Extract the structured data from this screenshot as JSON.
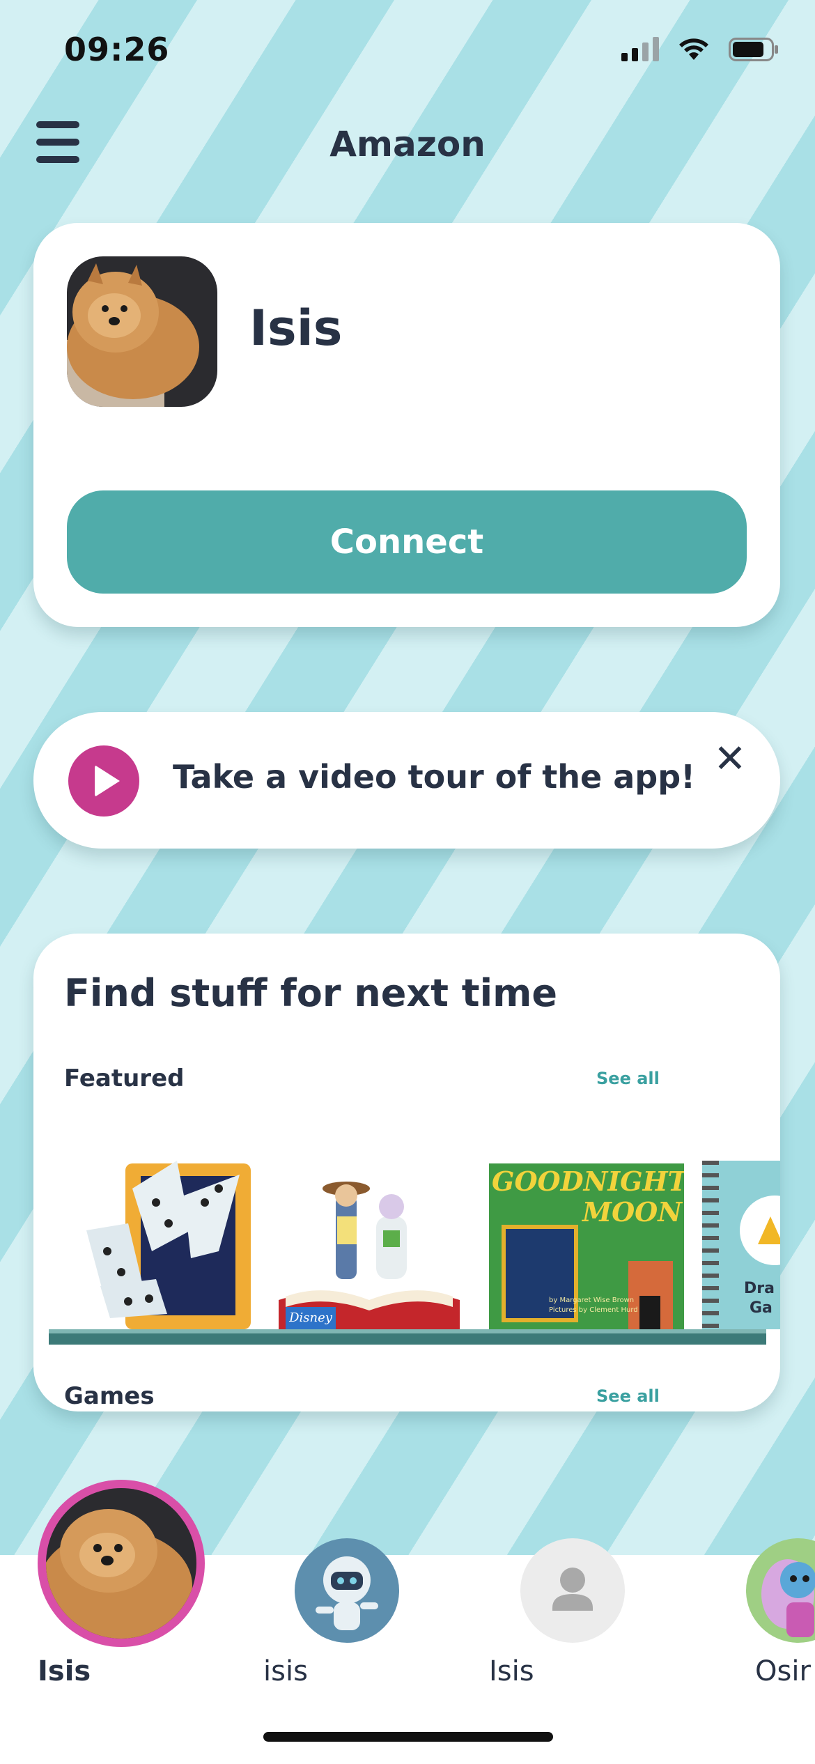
{
  "status_bar": {
    "time": "09:26"
  },
  "header": {
    "title": "Amazon"
  },
  "profile_card": {
    "name": "Isis",
    "connect_label": "Connect"
  },
  "tour_card": {
    "text": "Take a video tour of the app!"
  },
  "find_card": {
    "title": "Find stuff for next time",
    "featured_label": "Featured",
    "see_all_featured": "See all",
    "games_label": "Games",
    "see_all_games": "See all",
    "featured_items": [
      {
        "name": "dominoes-game",
        "icon": "dominoes-icon"
      },
      {
        "name": "disney-toy-story",
        "logo_text": "Disney"
      },
      {
        "name": "goodnight-moon-book",
        "title": "GOODNIGHT MOON",
        "byline1": "by Margaret Wise Brown",
        "byline2": "Pictures by Clement Hurd"
      },
      {
        "name": "draw-games",
        "partial_text_1": "Dra",
        "partial_text_2": "Ga"
      }
    ]
  },
  "profiles": [
    {
      "name": "Isis",
      "selected": true,
      "avatar": "dog-photo"
    },
    {
      "name": "isis",
      "selected": false,
      "avatar": "astronaut-robot"
    },
    {
      "name": "Isis",
      "selected": false,
      "avatar": "default-person"
    },
    {
      "name": "Osir",
      "selected": false,
      "avatar": "fairy"
    }
  ],
  "colors": {
    "accent": "#50acaa",
    "play": "#c63a8d",
    "selected_ring": "#d94fa8",
    "text": "#283245"
  }
}
